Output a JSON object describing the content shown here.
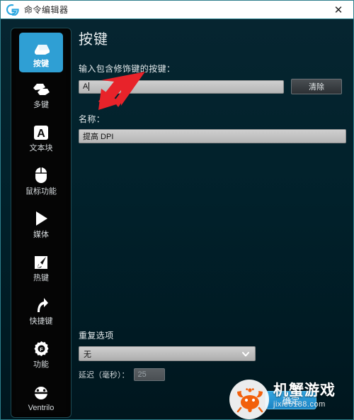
{
  "window": {
    "title": "命令编辑器",
    "close_label": "✕",
    "logo_icon": "logitech-g-logo"
  },
  "sidebar": {
    "items": [
      {
        "label": "按键",
        "icon": "keycap-icon",
        "selected": true
      },
      {
        "label": "多键",
        "icon": "multi-key-icon",
        "selected": false
      },
      {
        "label": "文本块",
        "icon": "text-block-a-icon",
        "selected": false
      },
      {
        "label": "鼠标功能",
        "icon": "mouse-icon",
        "selected": false
      },
      {
        "label": "媒体",
        "icon": "media-play-icon",
        "selected": false
      },
      {
        "label": "热键",
        "icon": "hotkey-cursor-icon",
        "selected": false
      },
      {
        "label": "快捷键",
        "icon": "shortcut-arrow-icon",
        "selected": false
      },
      {
        "label": "功能",
        "icon": "gear-f-icon",
        "selected": false
      },
      {
        "label": "Ventrilo",
        "icon": "ventrilo-icon",
        "selected": false
      }
    ]
  },
  "main": {
    "page_title": "按键",
    "key_input": {
      "label": "输入包含修饰键的按键：",
      "value": "A"
    },
    "clear_button": "清除",
    "name_field": {
      "label": "名称：",
      "value": "提高 DPI"
    },
    "repeat": {
      "title": "重复选项",
      "selected_option": "无",
      "options": [
        "无"
      ],
      "chevron_icon": "chevron-down-icon",
      "delay_label": "延迟（毫秒）：",
      "delay_value": "25"
    },
    "ok_button": "确定"
  },
  "annotation": {
    "arrow_icon": "red-arrow-pointing-down-left",
    "arrow_color": "#e8232a"
  },
  "watermark": {
    "brand": "机蟹游戏",
    "url": "jixie5188.com",
    "logo_icon": "orange-crab-icon",
    "color": "#f2600c"
  },
  "colors": {
    "accent_blue": "#2f9fd4",
    "background": "#01222c",
    "titlebar": "#ffffff",
    "border": "#2e7f8c"
  }
}
